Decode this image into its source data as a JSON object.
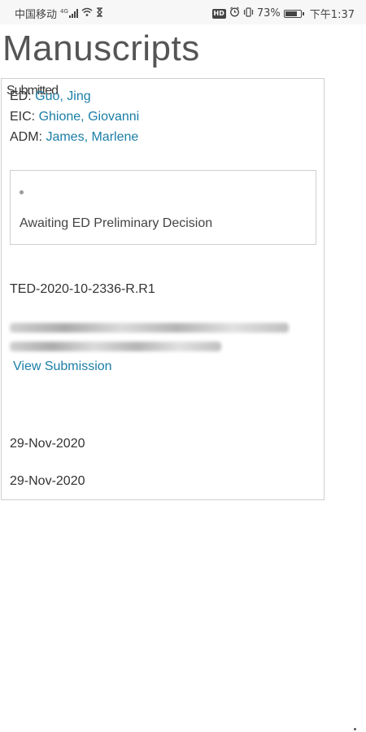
{
  "status_bar": {
    "carrier": "中国移动",
    "network_type": "4G",
    "battery_percent": "73%",
    "time": "下午1:37",
    "icons": [
      "signal-icon",
      "wifi-icon",
      "hourglass-icon",
      "hd-icon",
      "alarm-icon",
      "vibrate-icon",
      "battery-icon"
    ],
    "hd_label": "HD"
  },
  "page": {
    "title": "Manuscripts"
  },
  "manuscript": {
    "overlap_status_text": "Submitted",
    "ed_label": "ED:",
    "ed_name": "Guo, Jing",
    "eic_label": "EIC:",
    "eic_name": "Ghione, Giovanni",
    "adm_label": "ADM:",
    "adm_name": "James, Marlene",
    "status": "Awaiting ED Preliminary Decision",
    "manuscript_id": "TED-2020-10-2336-R.R1",
    "view_submission_label": "View Submission",
    "date_1": "29-Nov-2020",
    "date_2": "29-Nov-2020"
  },
  "colors": {
    "link": "#1a7ea7",
    "border": "#cfcfcf",
    "title": "#555555"
  }
}
